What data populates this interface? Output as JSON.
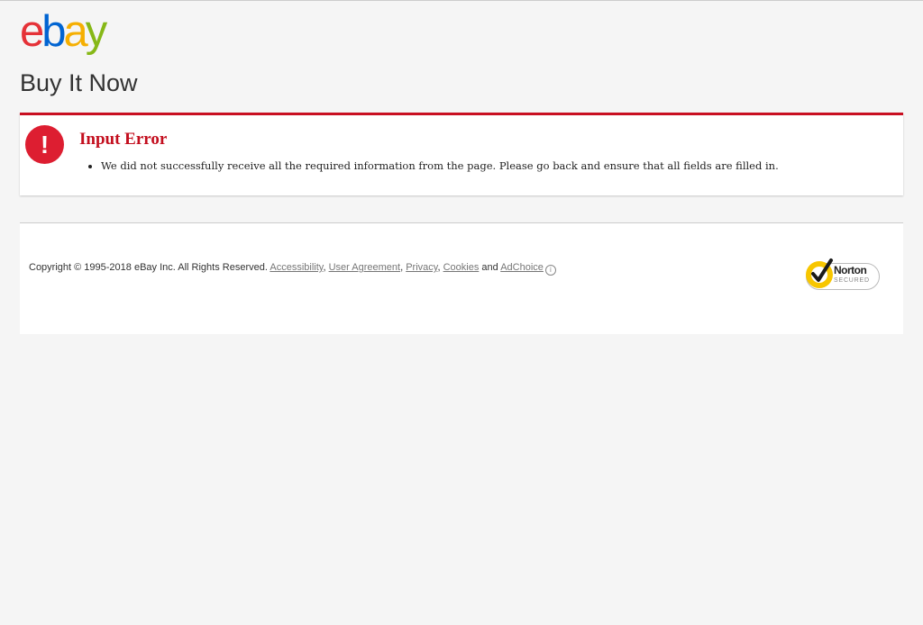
{
  "header": {
    "logo": {
      "e": "e",
      "b": "b",
      "a": "a",
      "y": "y"
    },
    "title": "Buy It Now"
  },
  "error": {
    "icon": "exclamation-icon",
    "icon_glyph": "!",
    "title": "Input Error",
    "messages": [
      "We did not successfully receive all the required information from the page. Please go back and ensure that all fields are filled in."
    ]
  },
  "footer": {
    "copyright": "Copyright © 1995-2018 eBay Inc. All Rights Reserved.",
    "links": {
      "accessibility": "Accessibility",
      "user_agreement": "User Agreement",
      "privacy": "Privacy",
      "cookies": "Cookies",
      "adchoice": "AdChoice"
    },
    "separator": ",",
    "and": "and",
    "norton": {
      "name": "Norton",
      "subtitle": "SECURED"
    }
  },
  "colors": {
    "error_red": "#c30e1e",
    "error_border": "#c90f21",
    "logo_red": "#e53238",
    "logo_blue": "#0064d2",
    "logo_yellow": "#f5af02",
    "logo_green": "#86b817",
    "norton_yellow": "#f7c600"
  }
}
